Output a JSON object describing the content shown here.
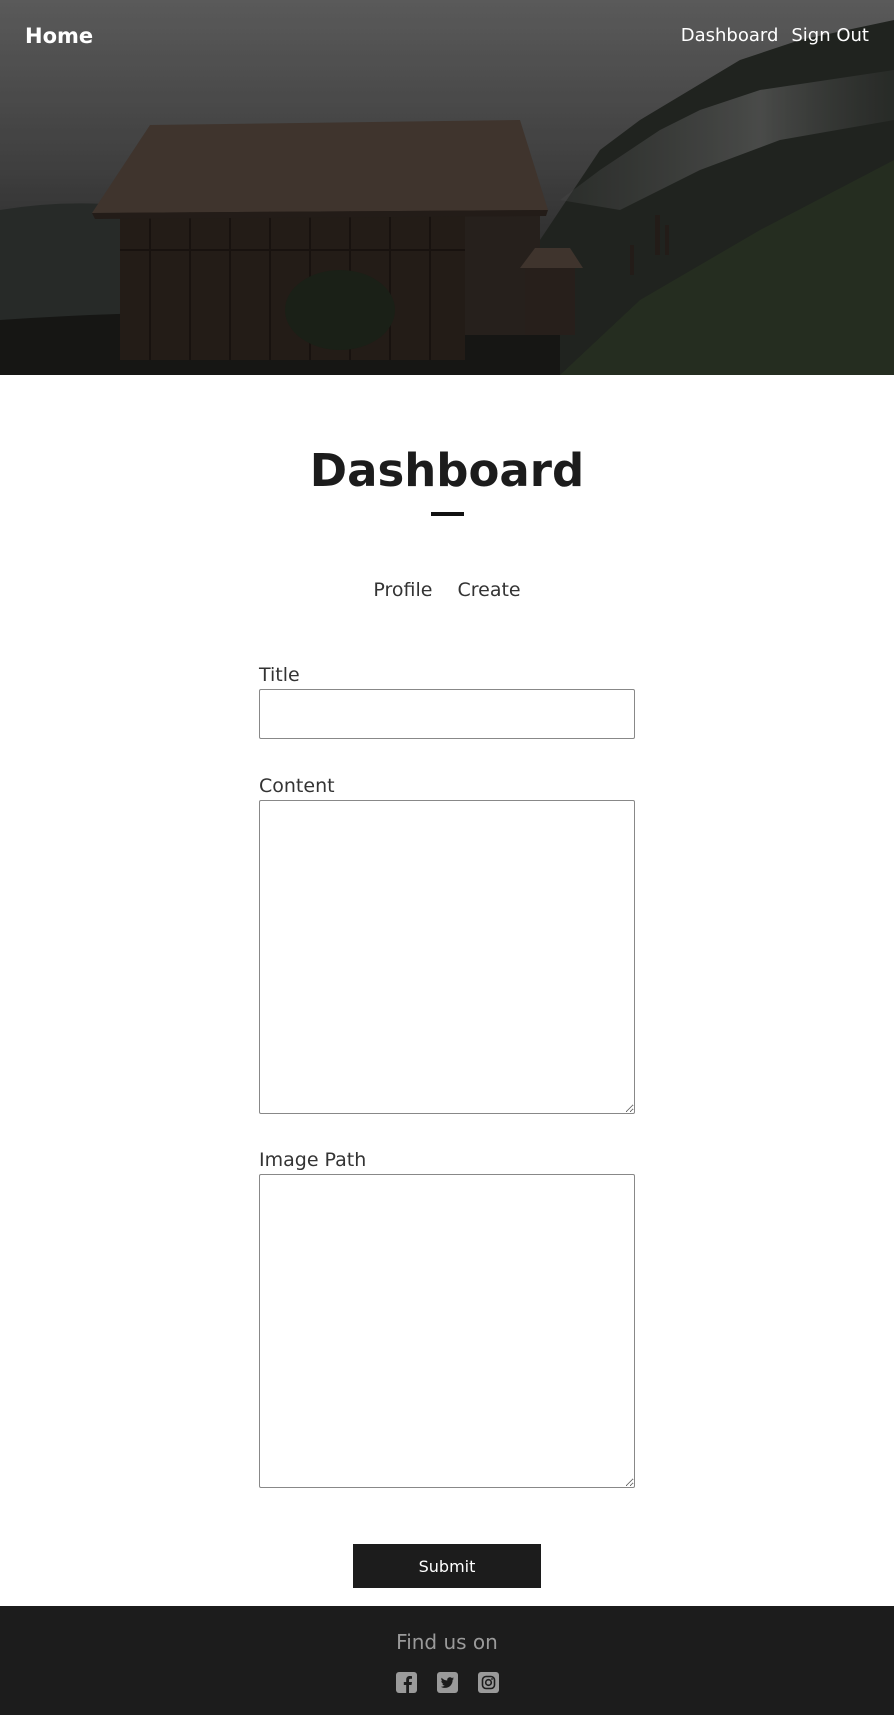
{
  "nav": {
    "home": "Home",
    "links": [
      "Dashboard",
      "Sign Out"
    ]
  },
  "page": {
    "title": "Dashboard"
  },
  "tabs": [
    "Profile",
    "Create"
  ],
  "form": {
    "title_label": "Title",
    "title_value": "",
    "content_label": "Content",
    "content_value": "",
    "image_label": "Image Path",
    "image_value": "",
    "submit_label": "Submit"
  },
  "footer": {
    "find_text": "Find us on",
    "socials": [
      "facebook-icon",
      "twitter-icon",
      "instagram-icon"
    ]
  },
  "colors": {
    "dark": "#1c1c1c",
    "footer_text": "#9a9a9a",
    "icon": "#9a9a9a"
  }
}
